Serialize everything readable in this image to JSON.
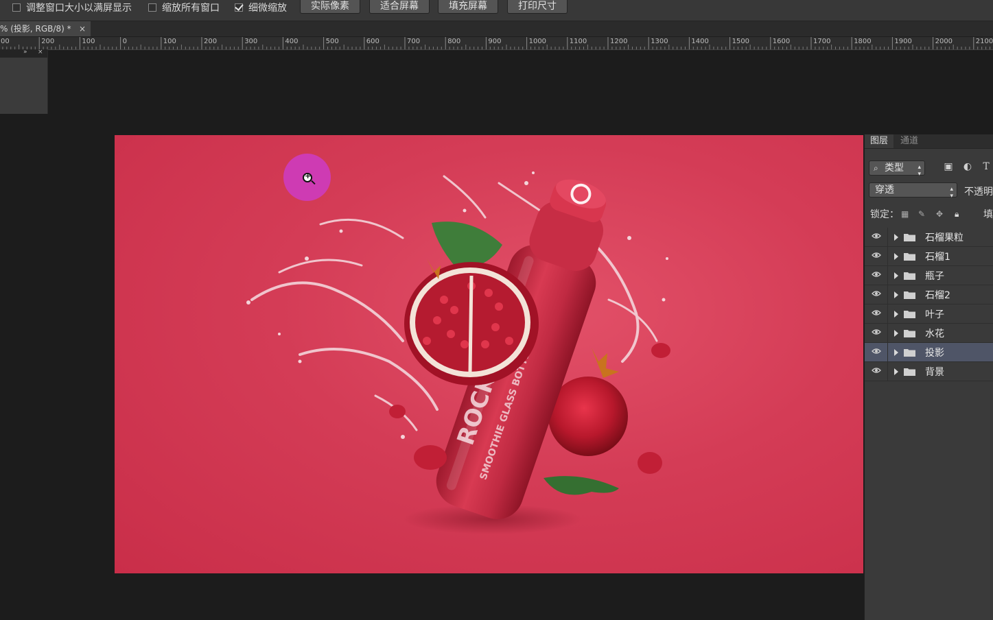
{
  "options_bar": {
    "checkboxes": [
      {
        "label": "调整窗口大小以满屏显示",
        "checked": false
      },
      {
        "label": "缩放所有窗口",
        "checked": false
      },
      {
        "label": "细微缩放",
        "checked": true
      }
    ],
    "buttons": [
      "实际像素",
      "适合屏幕",
      "填充屏幕",
      "打印尺寸"
    ]
  },
  "document_tab": {
    "title": "% (投影, RGB/8) *",
    "close": "×"
  },
  "ruler": {
    "labels": [
      "00",
      "200",
      "100",
      "0",
      "100",
      "200",
      "300",
      "400",
      "500",
      "600",
      "700",
      "800",
      "900",
      "1000",
      "1100",
      "1200",
      "1300",
      "1400",
      "1500",
      "1600",
      "1700",
      "1800",
      "1900",
      "2000",
      "2100"
    ]
  },
  "mini_panel": {
    "expand": "»",
    "close": "×"
  },
  "layers_panel": {
    "tabs": [
      "图层",
      "通道"
    ],
    "filter_kind": "类型",
    "blend_mode": "穿透",
    "opacity_label": "不透明",
    "lock_label": "锁定：",
    "fill_label": "填",
    "layers": [
      {
        "name": "石榴果粒",
        "selected": false
      },
      {
        "name": "石榴1",
        "selected": false
      },
      {
        "name": "瓶子",
        "selected": false
      },
      {
        "name": "石榴2",
        "selected": false
      },
      {
        "name": "叶子",
        "selected": false
      },
      {
        "name": "水花",
        "selected": false
      },
      {
        "name": "投影",
        "selected": true
      },
      {
        "name": "背景",
        "selected": false
      }
    ]
  },
  "canvas_artwork": {
    "bottle_text": "ROCK",
    "bottle_subtext": "SMOOTHIE GLASS BOTTLE"
  },
  "colors": {
    "canvas": "#d43c56",
    "selection": "#4f5567",
    "zoom_cursor": "#cd3cbe"
  }
}
